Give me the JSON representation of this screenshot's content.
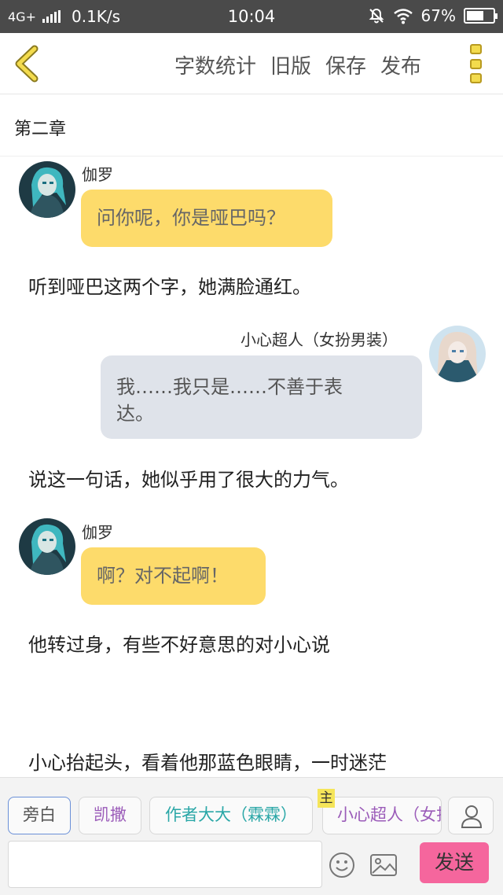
{
  "status_bar": {
    "network": "4G+",
    "speed": "0.1K/s",
    "time": "10:04",
    "battery": "67%",
    "battery_level": 0.67
  },
  "toolbar": {
    "actions": [
      "字数统计",
      "旧版",
      "保存",
      "发布"
    ]
  },
  "chapter": {
    "title": "第二章"
  },
  "messages": [
    {
      "sender": "伽罗",
      "text": "问你呢，你是哑巴吗？"
    },
    {
      "narration": "听到哑巴这两个字，她满脸通红。"
    },
    {
      "sender": "小心超人（女扮男装）",
      "text_lines": [
        "我……我只是……不善于表",
        "达。"
      ]
    },
    {
      "narration": "说这一句话，她似乎用了很大的力气。"
    },
    {
      "sender": "伽罗",
      "text": "啊？对不起啊！"
    },
    {
      "narration": "他转过身，有些不好意思的对小心说"
    },
    {
      "narration": "小心抬起头，看着他那蓝色眼睛，一时迷茫"
    }
  ],
  "roles": [
    {
      "label": "旁白",
      "selected": true
    },
    {
      "label": "凯撒"
    },
    {
      "label": "作者大大（霖霖）"
    },
    {
      "label": "小心超人（女扮男装）",
      "badge": "主"
    }
  ],
  "composer": {
    "send_label": "发送",
    "emoji_icon": "smiley-icon",
    "image_icon": "image-icon",
    "role_icon": "person-icon"
  },
  "colors": {
    "bubble_left": "#fddb6b",
    "bubble_right": "#dfe3ea",
    "send_button": "#f5669d",
    "menu_icon": "#f3db4d"
  }
}
